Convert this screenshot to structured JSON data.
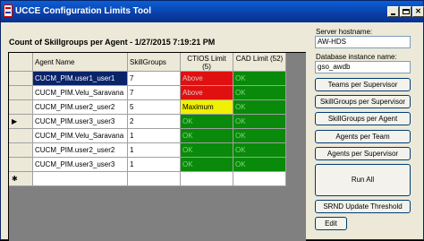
{
  "window": {
    "title": "UCCE Configuration Limits Tool"
  },
  "heading": "Count of Skillgroups per Agent - 1/27/2015 7:19:21 PM",
  "grid": {
    "columns": [
      "Agent Name",
      "SkillGroups",
      "CTIOS Limit (5)",
      "CAD Limit (52)"
    ],
    "rows": [
      {
        "agent": "CUCM_PIM.user1_user1",
        "skillgroups": "7",
        "ctios": "Above",
        "cad": "OK",
        "ctios_level": "above",
        "selected": true,
        "indicator": ""
      },
      {
        "agent": "CUCM_PIM.Velu_Saravana",
        "skillgroups": "7",
        "ctios": "Above",
        "cad": "OK",
        "ctios_level": "above",
        "selected": false,
        "indicator": ""
      },
      {
        "agent": "CUCM_PIM.user2_user2",
        "skillgroups": "5",
        "ctios": "Maximum",
        "cad": "OK",
        "ctios_level": "max",
        "selected": false,
        "indicator": ""
      },
      {
        "agent": "CUCM_PIM.user3_user3",
        "skillgroups": "2",
        "ctios": "OK",
        "cad": "OK",
        "ctios_level": "ok",
        "selected": false,
        "indicator": "▶"
      },
      {
        "agent": "CUCM_PIM.Velu_Saravana",
        "skillgroups": "1",
        "ctios": "OK",
        "cad": "OK",
        "ctios_level": "ok",
        "selected": false,
        "indicator": ""
      },
      {
        "agent": "CUCM_PIM.user2_user2",
        "skillgroups": "1",
        "ctios": "OK",
        "cad": "OK",
        "ctios_level": "ok",
        "selected": false,
        "indicator": ""
      },
      {
        "agent": "CUCM_PIM.user3_user3",
        "skillgroups": "1",
        "ctios": "OK",
        "cad": "OK",
        "ctios_level": "ok",
        "selected": false,
        "indicator": ""
      }
    ],
    "new_row_indicator": "✱"
  },
  "server": {
    "label": "Server hostname:",
    "value": "AW-HDS"
  },
  "database": {
    "label": "Database instance name:",
    "value": "gso_awdb"
  },
  "buttons": {
    "teams_per_supervisor": "Teams per Supervisor",
    "skillgroups_per_supervisor": "SkillGroups per Supervisor",
    "skillgroups_per_agent": "SkillGroups per Agent",
    "agents_per_team": "Agents per Team",
    "agents_per_supervisor": "Agents per Supervisor",
    "run_all": "Run All",
    "srnd_update_threshold": "SRND Update Threshold",
    "edit": "Edit"
  },
  "colors": {
    "above": "#e01010",
    "maximum": "#f0f000",
    "ok": "#0a8a0a",
    "selected": "#0a246a"
  }
}
